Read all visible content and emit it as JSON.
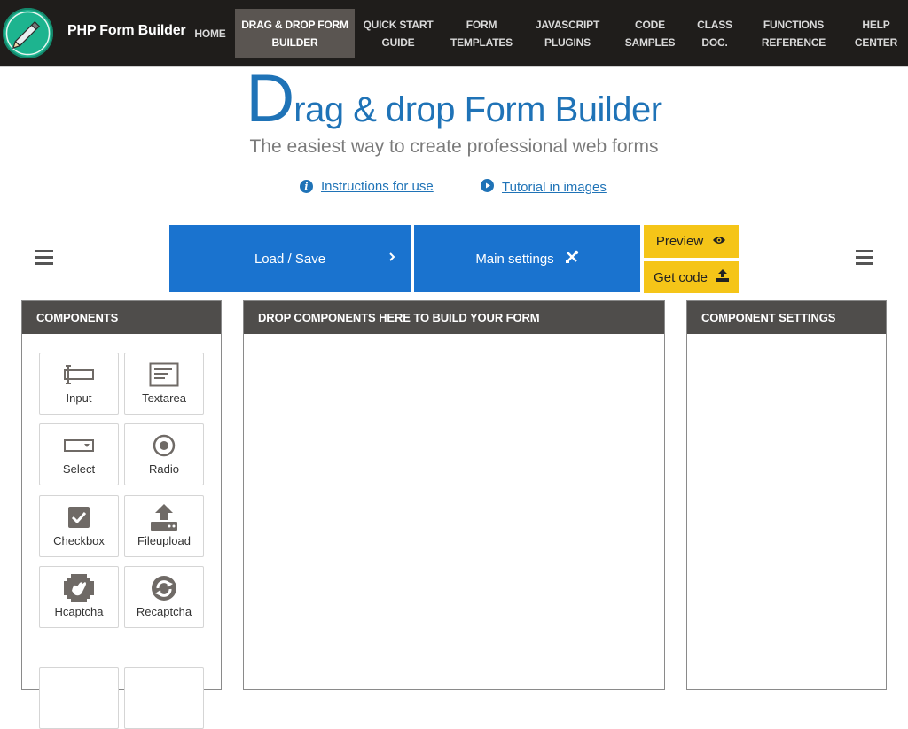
{
  "navbar": {
    "brand": "PHP Form Builder",
    "items": [
      {
        "line1": "HOME",
        "line2": ""
      },
      {
        "line1": "DRAG & DROP FORM",
        "line2": "BUILDER"
      },
      {
        "line1": "QUICK START",
        "line2": "GUIDE"
      },
      {
        "line1": "FORM",
        "line2": "TEMPLATES"
      },
      {
        "line1": "JAVASCRIPT",
        "line2": "PLUGINS"
      },
      {
        "line1": "CODE",
        "line2": "SAMPLES"
      },
      {
        "line1": "CLASS",
        "line2": "DOC."
      },
      {
        "line1": "FUNCTIONS",
        "line2": "REFERENCE"
      },
      {
        "line1": "HELP",
        "line2": "CENTER"
      }
    ],
    "active_index": 1
  },
  "hero": {
    "title_initial": "D",
    "title_rest": "rag & drop Form Builder",
    "subtitle": "The easiest way to create professional web forms",
    "links": [
      {
        "icon": "info-icon",
        "label": "Instructions for use"
      },
      {
        "icon": "play-circle-icon",
        "label": "Tutorial in images"
      }
    ]
  },
  "toolbar": {
    "load_save": "Load / Save",
    "main_settings": "Main settings",
    "preview": "Preview",
    "get_code": "Get code"
  },
  "panels": {
    "components": {
      "title": "COMPONENTS",
      "items": [
        {
          "label": "Input",
          "icon": "input-icon"
        },
        {
          "label": "Textarea",
          "icon": "textarea-icon"
        },
        {
          "label": "Select",
          "icon": "select-icon"
        },
        {
          "label": "Radio",
          "icon": "radio-icon"
        },
        {
          "label": "Checkbox",
          "icon": "checkbox-icon"
        },
        {
          "label": "Fileupload",
          "icon": "upload-icon"
        },
        {
          "label": "Hcaptcha",
          "icon": "hcaptcha-icon"
        },
        {
          "label": "Recaptcha",
          "icon": "recaptcha-icon"
        }
      ]
    },
    "dropzone": {
      "title": "DROP COMPONENTS HERE TO BUILD YOUR FORM"
    },
    "settings": {
      "title": "COMPONENT SETTINGS"
    }
  },
  "colors": {
    "navbar_bg": "#1f1d1b",
    "active_nav_bg": "#5a5551",
    "brand_logo": "#1db48f",
    "accent_blue": "#1a73cf",
    "title_blue": "#1f73b7",
    "accent_yellow": "#f5c518",
    "panel_header": "#4f4d4b"
  }
}
